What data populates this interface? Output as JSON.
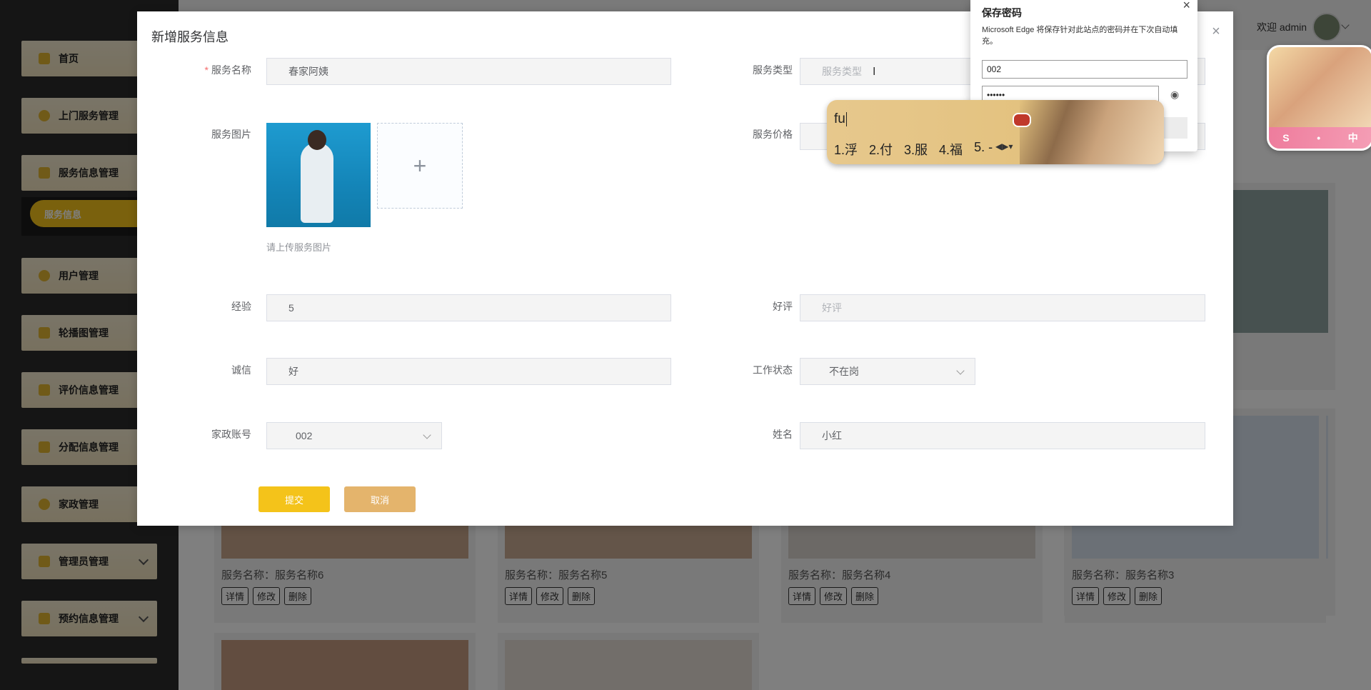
{
  "sidebar": {
    "items": [
      {
        "label": "首页",
        "icon": "home-icon"
      },
      {
        "label": "上门服务管理",
        "icon": "service-icon"
      },
      {
        "label": "服务信息管理",
        "icon": "grid-icon"
      },
      {
        "label": "用户管理",
        "icon": "user-icon"
      },
      {
        "label": "轮播图管理",
        "icon": "image-icon"
      },
      {
        "label": "评价信息管理",
        "icon": "list-icon"
      },
      {
        "label": "分配信息管理",
        "icon": "chart-icon"
      },
      {
        "label": "家政管理",
        "icon": "user-icon"
      },
      {
        "label": "管理员管理",
        "icon": "lock-icon"
      },
      {
        "label": "预约信息管理",
        "icon": "calendar-icon"
      }
    ],
    "active_sub": "服务信息"
  },
  "header": {
    "welcome": "欢迎 admin"
  },
  "cards": [
    {
      "name": "服务名称：服务名称6"
    },
    {
      "name": "服务名称：服务名称5"
    },
    {
      "name": "服务名称：服务名称4"
    },
    {
      "name": "服务名称：服务名称3"
    }
  ],
  "card_buttons": {
    "detail": "详情",
    "edit": "修改",
    "delete": "删除"
  },
  "dialog": {
    "title": "新增服务信息",
    "close": "×",
    "fields": {
      "service_name": {
        "label": "服务名称",
        "value": "春家阿姨"
      },
      "service_type": {
        "label": "服务类型",
        "placeholder": "服务类型"
      },
      "service_image": {
        "label": "服务图片",
        "hint": "请上传服务图片",
        "add": "+"
      },
      "service_price": {
        "label": "服务价格"
      },
      "experience": {
        "label": "经验",
        "value": "5"
      },
      "rating": {
        "label": "好评",
        "placeholder": "好评"
      },
      "integrity": {
        "label": "诚信",
        "value": "好"
      },
      "work_status": {
        "label": "工作状态",
        "value": "不在岗"
      },
      "account": {
        "label": "家政账号",
        "value": "002"
      },
      "name": {
        "label": "姓名",
        "value": "小红"
      }
    },
    "submit": "提交",
    "cancel": "取消"
  },
  "password_popup": {
    "title": "保存密码",
    "description": "Microsoft Edge 将保存针对此站点的密码并在下次自动填充。",
    "username": "002",
    "password": "••••••",
    "close": "×"
  },
  "ime": {
    "composition": "fu",
    "candidates": [
      "1.浮",
      "2.付",
      "3.服",
      "4.福",
      "5. -"
    ]
  },
  "float_widget": {
    "labels": [
      "S",
      "•",
      "中"
    ]
  }
}
